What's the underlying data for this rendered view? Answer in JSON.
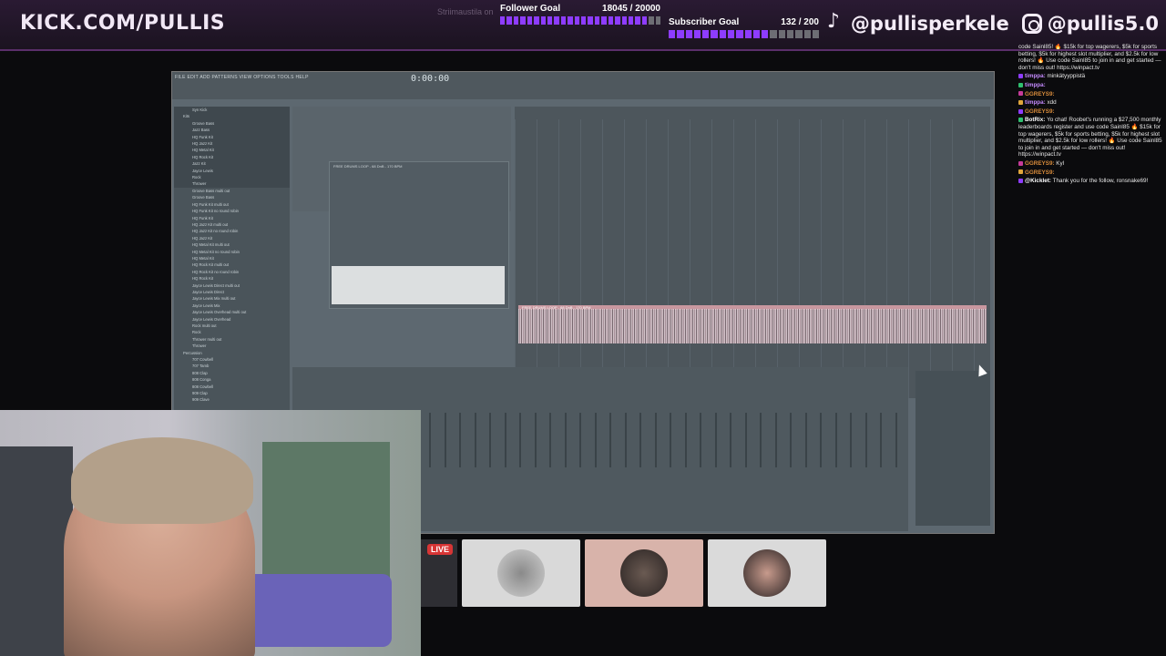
{
  "header": {
    "channel_url": "KICK.COM/PULLIS",
    "faint_title": "Striimaustila on",
    "follower_goal": {
      "label": "Follower Goal",
      "value": "18045 / 20000",
      "progress": 0.9
    },
    "subscriber_goal": {
      "label": "Subscriber Goal",
      "value": "132 / 200",
      "progress": 0.66
    },
    "tiktok_handle": "@pullisperkele",
    "instagram_handle": "@pullis5.0"
  },
  "chat": {
    "messages": [
      {
        "user": "",
        "text": "code Sainl85! 🔥 $15k for top wagerers, $5k for sports betting, $5k for highest slot multiplier, and $2.5k for low rollers! 🔥 Use code Sainl85 to join in and get started — don't miss out! https://winpact.tv"
      },
      {
        "user": "timppa:",
        "text": "minkätyyppistä"
      },
      {
        "user": "timppa:",
        "text": ""
      },
      {
        "user": "GGREYS9:",
        "text": ""
      },
      {
        "user": "timppa:",
        "text": "xdd"
      },
      {
        "user": "GGREYS9:",
        "text": ""
      },
      {
        "user": "BotRix:",
        "text": "Yo chat! Roobet's running a $27,500 monthly leaderboards register and use code Sainl85 🔥 $15k for top wagerers, $5k for sports betting, $5k for highest slot multiplier, and $2.5k for low rollers! 🔥 Use code Sainl85 to join in and get started — don't miss out! https://winpact.tv"
      },
      {
        "user": "GGREYS9:",
        "text": "Kyl"
      },
      {
        "user": "GGREYS9:",
        "text": ""
      },
      {
        "user": "@Kicklet:",
        "text": "Thank you for the follow, ronsnake69!"
      }
    ]
  },
  "daw": {
    "lcd_time": "0:00:00",
    "menu": "FILE EDIT ADD PATTERNS VIEW OPTIONS TOOLS HELP",
    "browser_items": [
      "Syn Kick",
      "Kits",
      "Groove Bass",
      "Jazz Bass",
      "HQ Funk Kit",
      "HQ Jazz Kit",
      "HQ Metal Kit",
      "HQ Rock Kit",
      "Jazz Kit",
      "Jayce Lewis",
      "Rock",
      "Thrower",
      "Groove Bass multi out",
      "Groove Bass",
      "HQ Funk Kit multi out",
      "HQ Funk Kit no round robin",
      "HQ Funk Kit",
      "HQ Jazz Kit multi out",
      "HQ Jazz Kit no round robin",
      "HQ Jazz Kit",
      "HQ Metal Kit multi out",
      "HQ Metal Kit no round robin",
      "HQ Metal Kit",
      "HQ Rock Kit multi out",
      "HQ Rock Kit no round robin",
      "HQ Rock Kit",
      "Jayce Lewis Direct multi out",
      "Jayce Lewis Direct",
      "Jayce Lewis Mix multi out",
      "Jayce Lewis Mix",
      "Jayce Lewis Overhead multi out",
      "Jayce Lewis Overhead",
      "Rock multi out",
      "Rock",
      "Thrower multi out",
      "Thrower",
      "Percussion",
      "707 Cowbell",
      "707 Tamb",
      "808 Clap",
      "808 Conga",
      "808 Cowbell",
      "909 Clap",
      "909 Clave"
    ],
    "sample_title": "FREE DRUMS LOOP - 68 DnB - 170 BPM",
    "playlist_track": "FREE DRUMS LOOP - 68 DnB - 170 BPM"
  },
  "guests": {
    "live_label": "LIVE"
  }
}
